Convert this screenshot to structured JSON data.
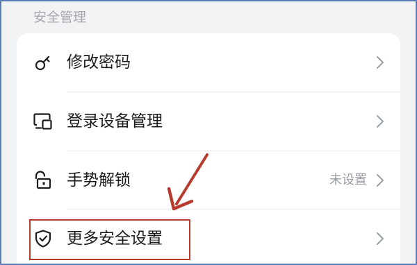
{
  "section": {
    "title": "安全管理"
  },
  "items": [
    {
      "label": "修改密码",
      "icon": "key-icon",
      "value": ""
    },
    {
      "label": "登录设备管理",
      "icon": "devices-icon",
      "value": ""
    },
    {
      "label": "手势解锁",
      "icon": "unlock-icon",
      "value": "未设置"
    },
    {
      "label": "更多安全设置",
      "icon": "shield-check-icon",
      "value": ""
    }
  ],
  "colors": {
    "background": "#f2f3f5",
    "card": "#ffffff",
    "annotation": "#b73b2c",
    "frame": "#5b7bb5"
  }
}
